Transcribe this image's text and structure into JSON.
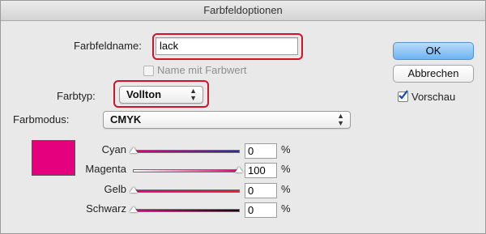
{
  "window": {
    "title": "Farbfeldoptionen"
  },
  "swatch_name": {
    "label": "Farbfeldname:",
    "value": "lack"
  },
  "name_with_value": {
    "label": "Name mit Farbwert",
    "checked": false,
    "enabled": false
  },
  "color_type": {
    "label": "Farbtyp:",
    "value": "Vollton"
  },
  "color_mode": {
    "label": "Farbmodus:",
    "value": "CMYK"
  },
  "swatch_color": "#e5007e",
  "sliders": [
    {
      "label": "Cyan",
      "value": "0",
      "unit": "%",
      "fraction": 0,
      "gradient": [
        "#e5007e",
        "#2a2e8e"
      ]
    },
    {
      "label": "Magenta",
      "value": "100",
      "unit": "%",
      "fraction": 1,
      "gradient": [
        "#ffffff",
        "#e5007e"
      ]
    },
    {
      "label": "Gelb",
      "value": "0",
      "unit": "%",
      "fraction": 0,
      "gradient": [
        "#e5007e",
        "#e4202e"
      ]
    },
    {
      "label": "Schwarz",
      "value": "0",
      "unit": "%",
      "fraction": 0,
      "gradient": [
        "#e5007e",
        "#1a0010"
      ]
    }
  ],
  "buttons": {
    "ok": "OK",
    "cancel": "Abbrechen"
  },
  "preview": {
    "label": "Vorschau",
    "checked": true
  },
  "colors": {
    "highlight": "#d1122b",
    "accent": "#4a90e2"
  }
}
